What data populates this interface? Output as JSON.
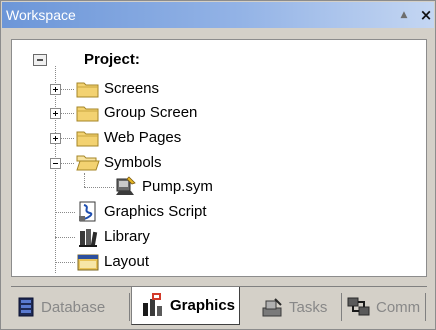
{
  "window": {
    "title": "Workspace",
    "pin_label": "▲",
    "close_label": "×"
  },
  "tree": {
    "root": "Project:",
    "items": [
      "Screens",
      "Group Screen",
      "Web Pages",
      "Symbols",
      "Pump.sym",
      "Graphics Script",
      "Library",
      "Layout"
    ]
  },
  "tabs": [
    {
      "label": "Database",
      "icon": "database-icon",
      "active": false
    },
    {
      "label": "Graphics",
      "icon": "graphics-icon",
      "active": true
    },
    {
      "label": "Tasks",
      "icon": "tasks-icon",
      "active": false
    },
    {
      "label": "Comm",
      "icon": "comm-icon",
      "active": false
    }
  ],
  "colors": {
    "title_gradient_start": "#6c96d8",
    "title_gradient_end": "#c4d6f2",
    "folder_yellow": "#f3d271",
    "tree_lines": "#8a8a8a"
  }
}
